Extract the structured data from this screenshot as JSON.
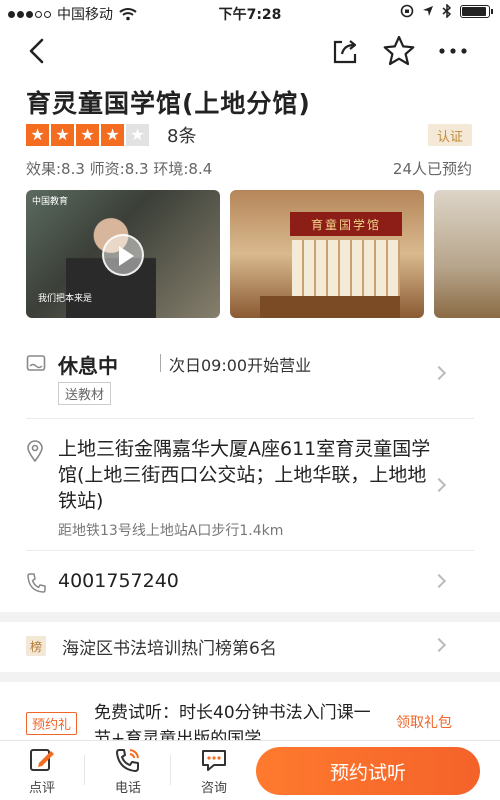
{
  "status_bar": {
    "carrier": "中国移动",
    "time": "下午7:28",
    "battery_level": 0.85
  },
  "header": {
    "back_icon": "back-arrow-icon",
    "share_icon": "share-icon",
    "favorite_icon": "star-outline-icon",
    "more_icon": "more-dots-icon"
  },
  "venue": {
    "name": "育灵童国学馆(上地分馆)",
    "rating_stars": 4,
    "rating_max": 5,
    "review_count": "8条",
    "certified_label": "认证",
    "scores": "效果:8.3 师资:8.3 环境:8.4",
    "booked": "24人已预约"
  },
  "photos": {
    "photo1_tag": "中国教育",
    "photo1_caption": "我们把本来是",
    "photo2_sign": "育童国学馆"
  },
  "hours": {
    "status": "休息中",
    "next_open": "次日09:00开始营业",
    "feature_tag": "送教材"
  },
  "location": {
    "address": "上地三街金隅嘉华大厦A座611室育灵童国学馆(上地三街西口公交站；上地华联，上地地铁站)",
    "distance": "距地铁13号线上地站A口步行1.4km"
  },
  "contact": {
    "phone": "4001757240"
  },
  "ranking": {
    "badge": "榜",
    "text": "海淀区书法培训热门榜第6名"
  },
  "promotion": {
    "tag": "预约礼",
    "text": "免费试听：时长40分钟书法入门课一节+育灵童出版的国学",
    "link": "领取礼包"
  },
  "bottom_bar": {
    "review_label": "点评",
    "phone_label": "电话",
    "consult_label": "咨询",
    "cta_label": "预约试听"
  },
  "colors": {
    "accent": "#f46c1f",
    "cert_bg": "#f4e9d6",
    "cert_text": "#c08a3e"
  }
}
